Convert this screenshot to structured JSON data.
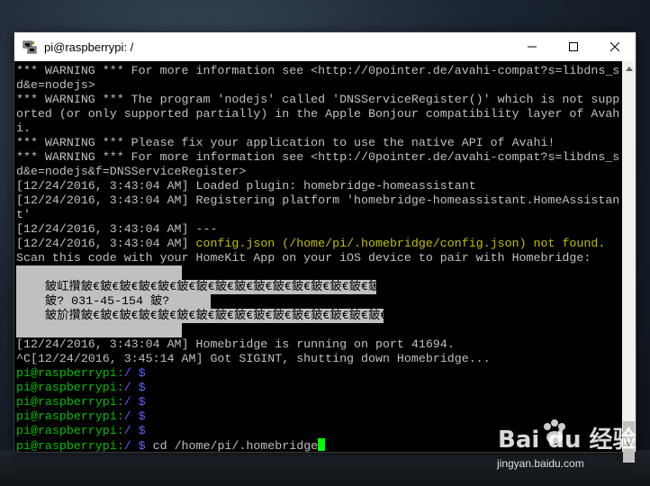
{
  "window": {
    "title": "pi@raspberrypi: /",
    "icon": "putty-icon",
    "controls": [
      "minimize-icon",
      "maximize-icon",
      "close-icon"
    ]
  },
  "terminal": {
    "lines_before_qr": [
      [
        {
          "t": "*** WARNING *** For more information see <http://0pointer.de/avahi-compat?s=libdns_s",
          "c": ""
        }
      ],
      [
        {
          "t": "d&e=nodejs>",
          "c": ""
        }
      ],
      [
        {
          "t": "*** WARNING *** The program 'nodejs' called 'DNSServiceRegister()' which is not supp",
          "c": ""
        }
      ],
      [
        {
          "t": "orted (or only supported partially) in the Apple Bonjour compatibility layer of Avah",
          "c": ""
        }
      ],
      [
        {
          "t": "i.",
          "c": ""
        }
      ],
      [
        {
          "t": "*** WARNING *** Please fix your application to use the native API of Avahi!",
          "c": ""
        }
      ],
      [
        {
          "t": "*** WARNING *** For more information see <http://0pointer.de/avahi-compat?s=libdns_s",
          "c": ""
        }
      ],
      [
        {
          "t": "d&e=nodejs&f=DNSServiceRegister>",
          "c": ""
        }
      ],
      [
        {
          "t": "[12/24/2016, 3:43:04 AM] Loaded plugin: homebridge-homeassistant",
          "c": ""
        }
      ],
      [
        {
          "t": "[12/24/2016, 3:43:04 AM] Registering platform 'homebridge-homeassistant.HomeAssistan",
          "c": ""
        }
      ],
      [
        {
          "t": "t'",
          "c": ""
        }
      ],
      [
        {
          "t": "[12/24/2016, 3:43:04 AM] ---",
          "c": ""
        }
      ],
      [
        {
          "t": "[12/24/2016, 3:43:04 AM] ",
          "c": ""
        },
        {
          "t": "config.json (/home/pi/.homebridge/config.json) not found.",
          "c": "yellow"
        }
      ],
      [
        {
          "t": "Scan this code with your HomeKit App on your iOS device to pair with Homebridge:",
          "c": ""
        }
      ]
    ],
    "qr_rows": [
      "    鈹屸攢鈹€鈹€鈹€鈹€鈹€鈹€鈹€鈹€鈹€鈹€鈹€鈹€鈹€鈹€鈹€鈹€",
      "    鈹? 031-45-154 鈹?",
      "    鈹斺攢鈹€鈹€鈹€鈹€鈹€鈹€鈹€鈹€鈹€鈹€鈹€鈹€鈹€鈹€鈹€鈹€鈹?"
    ],
    "lines_after_qr": [
      [
        {
          "t": "[12/24/2016, 3:43:04 AM] Homebridge is running on port 41694.",
          "c": ""
        }
      ],
      [
        {
          "t": "^C[12/24/2016, 3:45:14 AM] Got SIGINT, shutting down Homebridge...",
          "c": ""
        }
      ],
      [
        {
          "t": "pi@raspberrypi:",
          "c": "green"
        },
        {
          "t": "/ $",
          "c": "blue"
        }
      ],
      [
        {
          "t": "pi@raspberrypi:",
          "c": "green"
        },
        {
          "t": "/ $",
          "c": "blue"
        }
      ],
      [
        {
          "t": "pi@raspberrypi:",
          "c": "green"
        },
        {
          "t": "/ $",
          "c": "blue"
        }
      ],
      [
        {
          "t": "pi@raspberrypi:",
          "c": "green"
        },
        {
          "t": "/ $",
          "c": "blue"
        }
      ],
      [
        {
          "t": "pi@raspberrypi:",
          "c": "green"
        },
        {
          "t": "/ $",
          "c": "blue"
        }
      ]
    ],
    "prompt": {
      "user_host": "pi@raspberrypi:",
      "path": "/ $",
      "command": " cd /home/pi/.homebridge"
    },
    "colors": {
      "background": "#000000",
      "text": "#c0c0c0",
      "prompt_green": "#00c000",
      "path_blue": "#6060ff",
      "warning_yellow": "#c0c000",
      "cursor": "#00ff00"
    }
  },
  "watermark": {
    "logo": "Bai du 经验",
    "url": "jingyan.baidu.com"
  }
}
